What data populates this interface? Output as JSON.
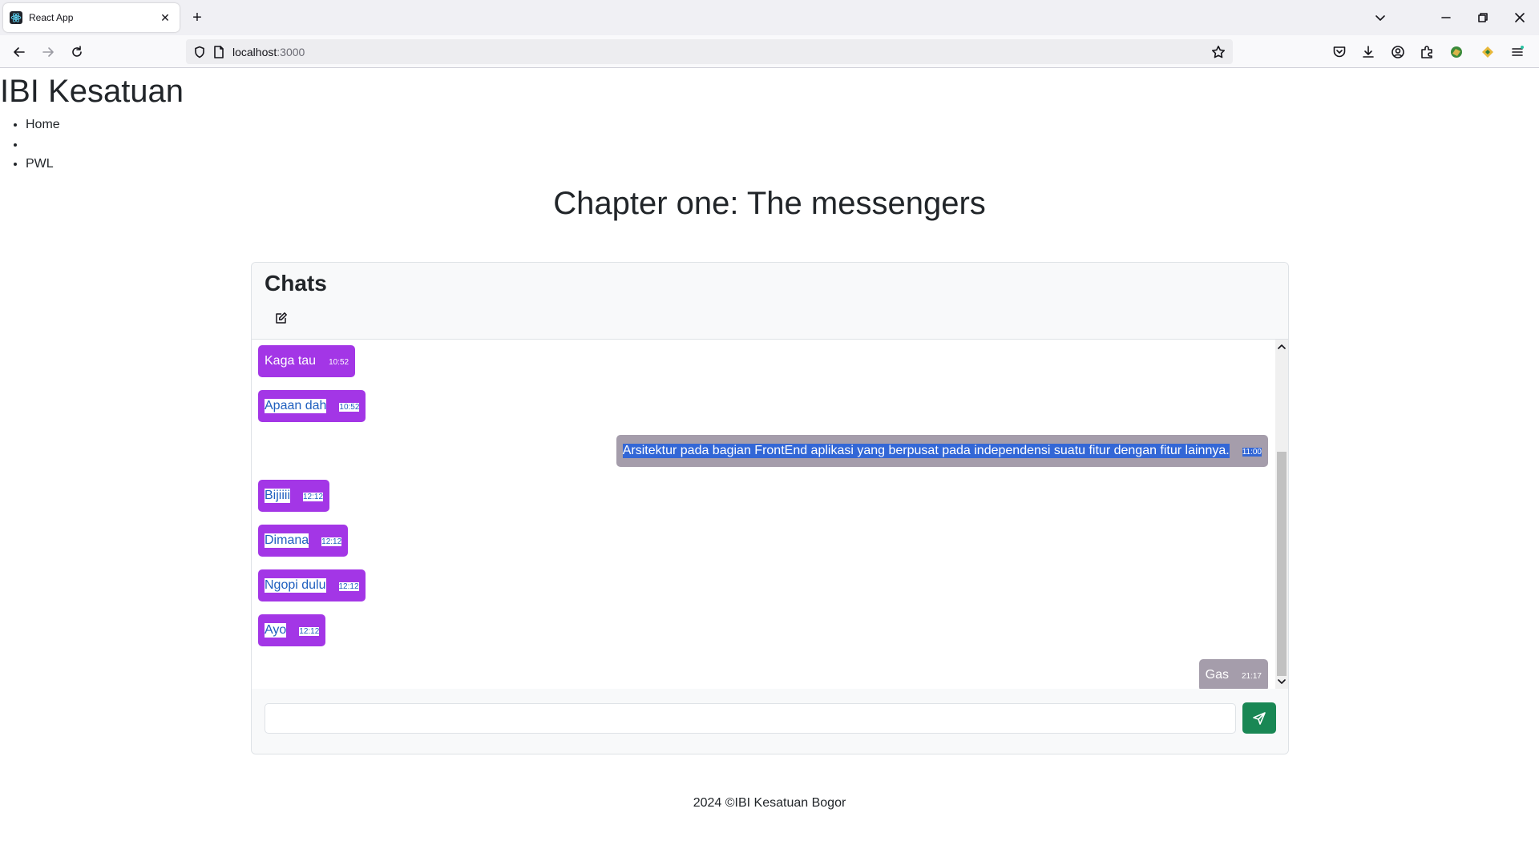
{
  "browser": {
    "tab_title": "React App",
    "tab_close": "✕",
    "new_tab": "+",
    "url_host": "localhost",
    "url_port": ":3000",
    "icons": [
      "back-icon",
      "forward-icon",
      "reload-icon",
      "shield-icon",
      "page-icon",
      "star-icon",
      "pocket-icon",
      "download-icon",
      "account-icon",
      "extensions-icon",
      "extension-green-icon",
      "extension-yellow-icon",
      "menu-icon"
    ]
  },
  "site": {
    "brand": "IBI Kesatuan",
    "nav": [
      "Home",
      "",
      "PWL"
    ],
    "chapter_title": "Chapter one: The messengers"
  },
  "chat": {
    "title": "Chats",
    "incoming_color": "#a336e6",
    "outgoing_color": "#a59dab",
    "messages": [
      {
        "text": "Kaga tau",
        "time": "10:52",
        "side": "in"
      },
      {
        "text": "Apaan dah",
        "time": "10:52",
        "side": "in"
      },
      {
        "text": "Arsitektur pada bagian FrontEnd aplikasi yang berpusat pada independensi suatu fitur dengan fitur lainnya.",
        "time": "11:00",
        "side": "out"
      },
      {
        "text": "Bijiiii",
        "time": "12:12",
        "side": "in"
      },
      {
        "text": "Dimana",
        "time": "12:12",
        "side": "in"
      },
      {
        "text": "Ngopi dulu",
        "time": "12:12",
        "side": "in"
      },
      {
        "text": "Ayo",
        "time": "12:12",
        "side": "in"
      },
      {
        "text": "Gas",
        "time": "21:17",
        "side": "out"
      }
    ],
    "input_value": "",
    "input_placeholder": "",
    "send_color": "#198754"
  },
  "footer": {
    "text": "2024 ©IBI Kesatuan Bogor"
  }
}
